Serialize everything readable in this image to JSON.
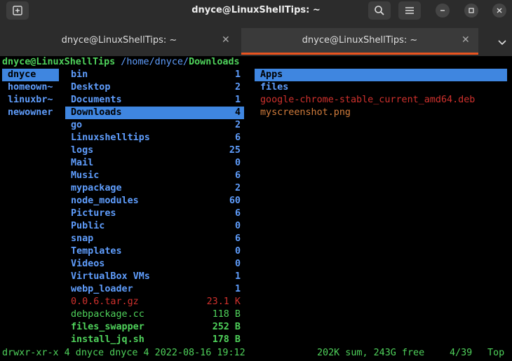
{
  "window": {
    "title": "dnyce@LinuxShellTips: ~"
  },
  "tabs": [
    {
      "label": "dnyce@LinuxShellTips: ~",
      "active": false
    },
    {
      "label": "dnyce@LinuxShellTips: ~",
      "active": true
    }
  ],
  "prompt": {
    "user_host": "dnyce@LinuxShellTips",
    "path": " /home/dnyce/",
    "current": "Downloads"
  },
  "parent_column": [
    {
      "name": "dnyce",
      "selected": true
    },
    {
      "name": "homeown~",
      "selected": false
    },
    {
      "name": "linuxbr~",
      "selected": false
    },
    {
      "name": "newowner",
      "selected": false
    }
  ],
  "current_column": [
    {
      "name": "bin",
      "size": "1",
      "kind": "dir"
    },
    {
      "name": "Desktop",
      "size": "2",
      "kind": "dir"
    },
    {
      "name": "Documents",
      "size": "1",
      "kind": "dir"
    },
    {
      "name": "Downloads",
      "size": "4",
      "kind": "dir",
      "selected": true
    },
    {
      "name": "go",
      "size": "2",
      "kind": "dir"
    },
    {
      "name": "Linuxshelltips",
      "size": "6",
      "kind": "dir"
    },
    {
      "name": "logs",
      "size": "25",
      "kind": "dir"
    },
    {
      "name": "Mail",
      "size": "0",
      "kind": "dir"
    },
    {
      "name": "Music",
      "size": "6",
      "kind": "dir"
    },
    {
      "name": "mypackage",
      "size": "2",
      "kind": "dir"
    },
    {
      "name": "node_modules",
      "size": "60",
      "kind": "dir"
    },
    {
      "name": "Pictures",
      "size": "6",
      "kind": "dir"
    },
    {
      "name": "Public",
      "size": "0",
      "kind": "dir"
    },
    {
      "name": "snap",
      "size": "6",
      "kind": "dir"
    },
    {
      "name": "Templates",
      "size": "0",
      "kind": "dir"
    },
    {
      "name": "Videos",
      "size": "0",
      "kind": "dir"
    },
    {
      "name": "VirtualBox VMs",
      "size": "1",
      "kind": "dir"
    },
    {
      "name": "webp_loader",
      "size": "1",
      "kind": "dir"
    },
    {
      "name": "0.0.6.tar.gz",
      "size": "23.1 K",
      "kind": "arch"
    },
    {
      "name": "debpackage.cc",
      "size": "118 B",
      "kind": "src"
    },
    {
      "name": "files_swapper",
      "size": "252 B",
      "kind": "exec"
    },
    {
      "name": "install_jq.sh",
      "size": "178 B",
      "kind": "exec"
    }
  ],
  "preview_column": [
    {
      "name": "Apps",
      "kind": "dir",
      "selected": true
    },
    {
      "name": "files",
      "kind": "dir"
    },
    {
      "name": "google-chrome-stable_current_amd64.deb",
      "kind": "arch"
    },
    {
      "name": "myscreenshot.png",
      "kind": "img"
    }
  ],
  "statusbar": {
    "perms": "drwxr-xr-x 4 dnyce dnyce 4 2022-08-16 19:12",
    "summary": "202K sum, 243G free",
    "position": "4/39",
    "scroll": "Top"
  }
}
